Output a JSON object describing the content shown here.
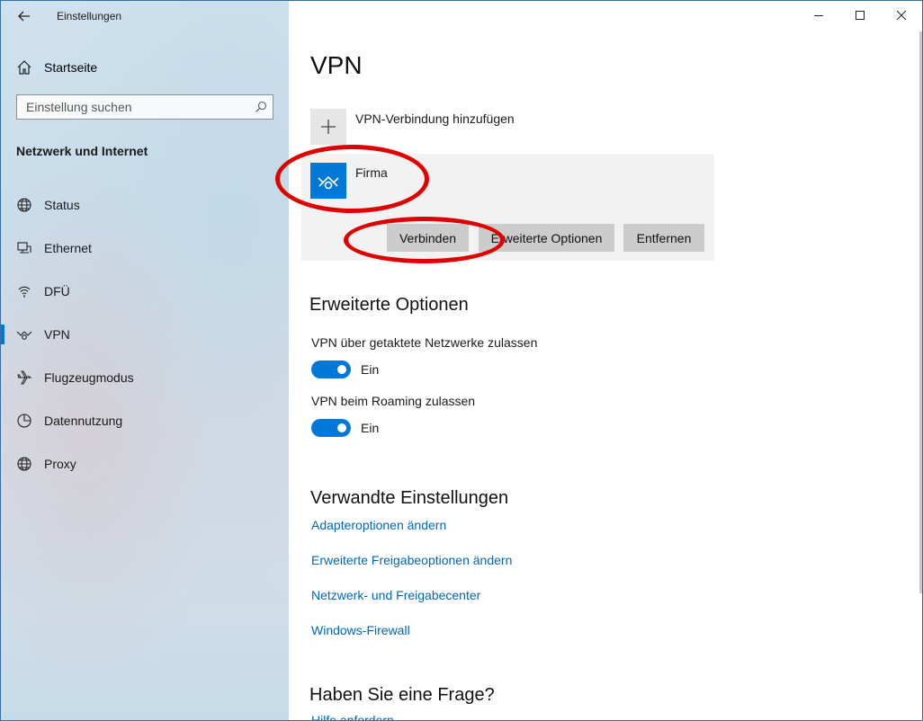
{
  "window": {
    "title": "Einstellungen"
  },
  "sidebar": {
    "home_label": "Startseite",
    "search_placeholder": "Einstellung suchen",
    "section_title": "Netzwerk und Internet",
    "items": [
      {
        "label": "Status",
        "icon": "globe-icon"
      },
      {
        "label": "Ethernet",
        "icon": "ethernet-icon"
      },
      {
        "label": "DFÜ",
        "icon": "dialup-icon"
      },
      {
        "label": "VPN",
        "icon": "vpn-icon",
        "selected": true
      },
      {
        "label": "Flugzeugmodus",
        "icon": "airplane-icon"
      },
      {
        "label": "Datennutzung",
        "icon": "data-usage-icon"
      },
      {
        "label": "Proxy",
        "icon": "globe-icon"
      }
    ]
  },
  "main": {
    "title": "VPN",
    "add_vpn_label": "VPN-Verbindung hinzufügen",
    "connection": {
      "name": "Firma",
      "buttons": {
        "connect": "Verbinden",
        "advanced": "Erweiterte Optionen",
        "remove": "Entfernen"
      }
    },
    "advanced": {
      "heading": "Erweiterte Optionen",
      "options": [
        {
          "label": "VPN über getaktete Netzwerke zulassen",
          "state": "Ein",
          "on": true
        },
        {
          "label": "VPN beim Roaming zulassen",
          "state": "Ein",
          "on": true
        }
      ]
    },
    "related": {
      "heading": "Verwandte Einstellungen",
      "links": [
        "Adapteroptionen ändern",
        "Erweiterte Freigabeoptionen ändern",
        "Netzwerk- und Freigabecenter",
        "Windows-Firewall"
      ]
    },
    "question": {
      "heading": "Haben Sie eine Frage?",
      "link": "Hilfe anfordern"
    }
  },
  "colors": {
    "accent": "#0078d7",
    "link": "#0067b8",
    "annotation": "#e00000"
  }
}
